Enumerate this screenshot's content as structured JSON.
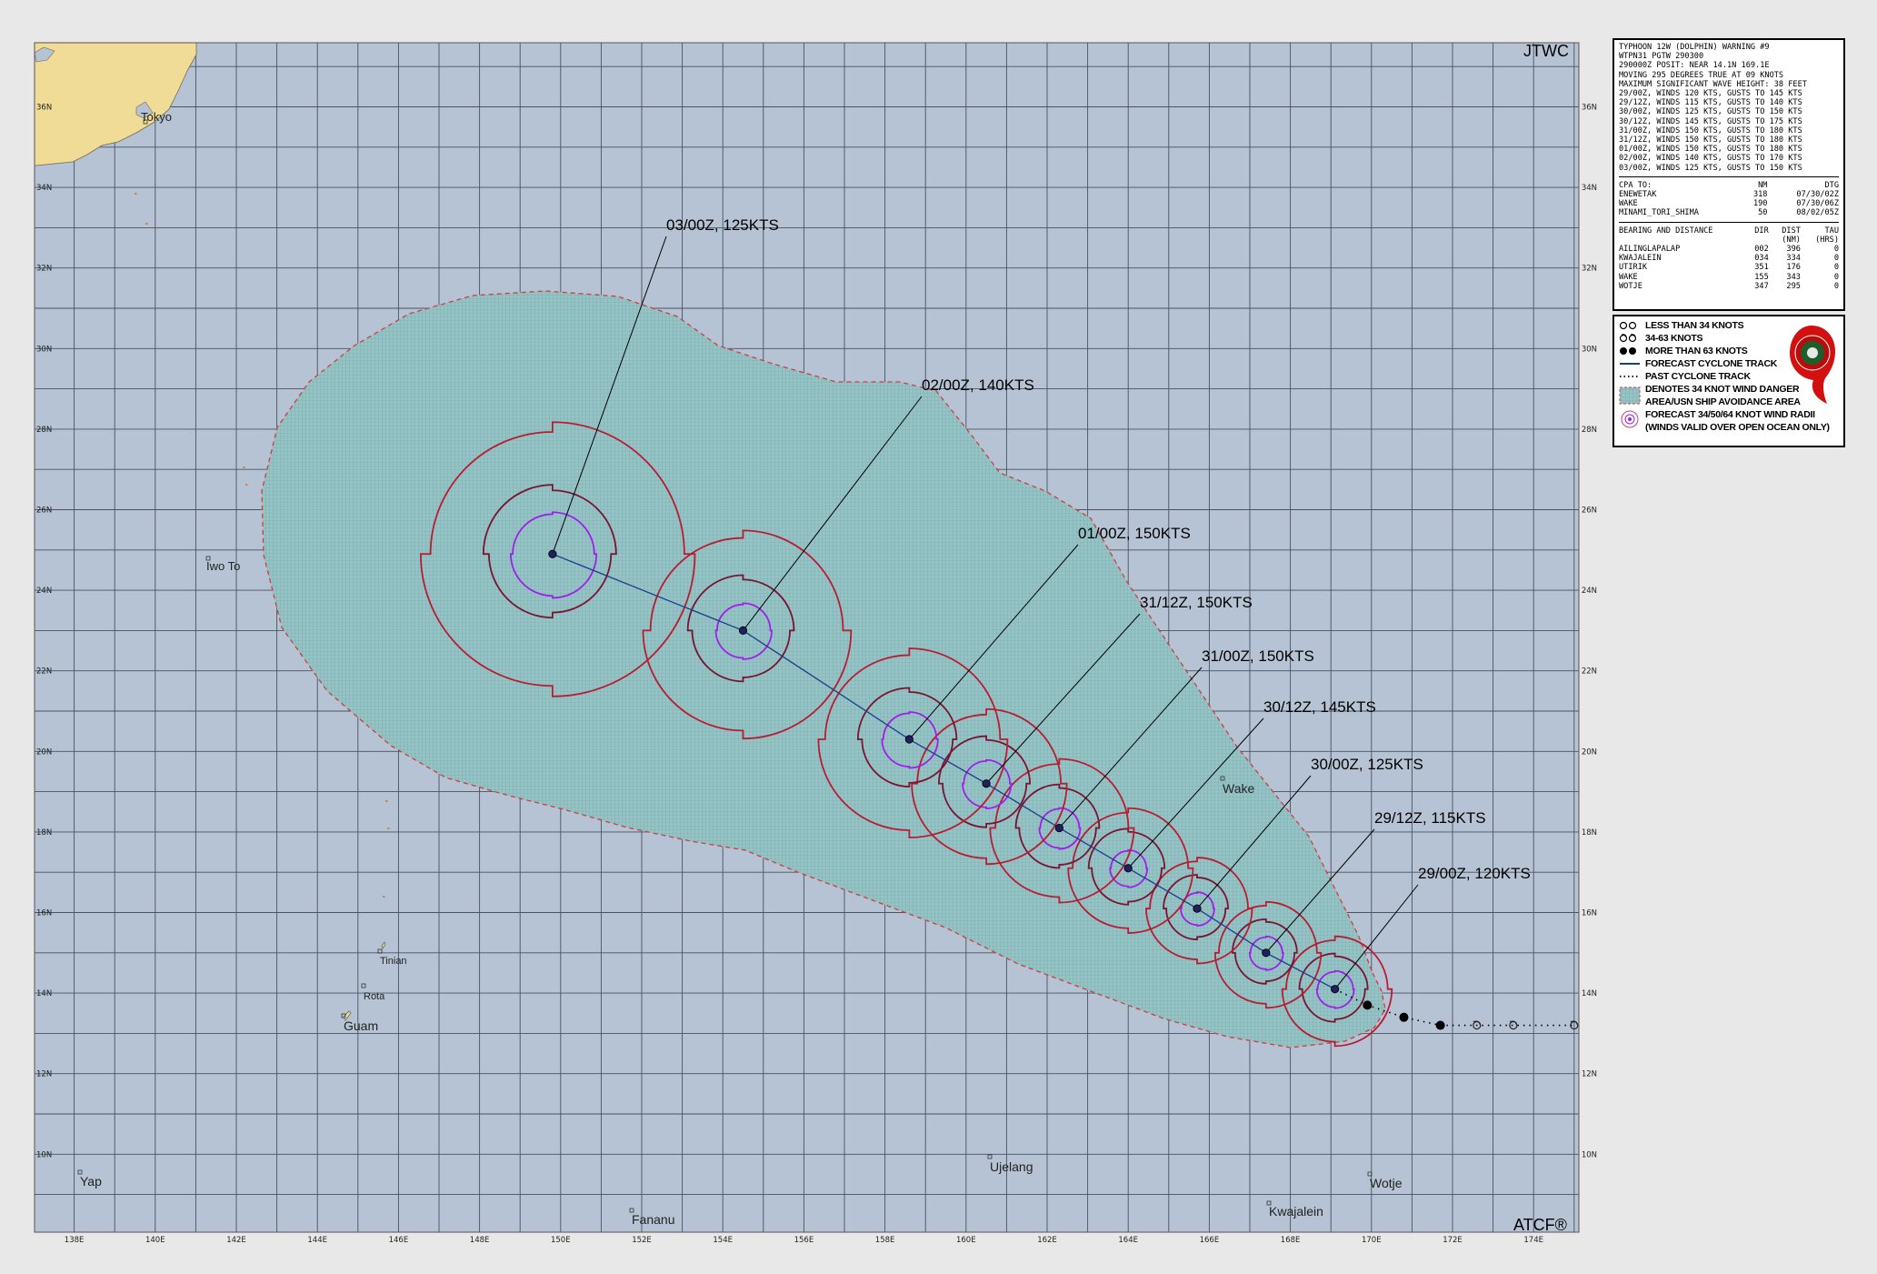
{
  "agency": "JTWC",
  "footer": "ATCF®",
  "lat_labels": [
    "36N",
    "34N",
    "32N",
    "30N",
    "28N",
    "26N",
    "24N",
    "22N",
    "20N",
    "18N",
    "16N",
    "14N",
    "12N",
    "10N"
  ],
  "lon_labels": [
    "138E",
    "140E",
    "142E",
    "144E",
    "146E",
    "148E",
    "150E",
    "152E",
    "154E",
    "156E",
    "158E",
    "160E",
    "162E",
    "164E",
    "166E",
    "168E",
    "170E",
    "172E",
    "174E"
  ],
  "places": [
    {
      "name": "Tokyo"
    },
    {
      "name": "Iwo To"
    },
    {
      "name": "Tinian"
    },
    {
      "name": "Rota"
    },
    {
      "name": "Guam"
    },
    {
      "name": "Yap"
    },
    {
      "name": "Fananu"
    },
    {
      "name": "Ujelang"
    },
    {
      "name": "Kwajalein"
    },
    {
      "name": "Wotje"
    },
    {
      "name": "Wake"
    }
  ],
  "forecast_labels": [
    "03/00Z, 125KTS",
    "02/00Z, 140KTS",
    "01/00Z, 150KTS",
    "31/12Z, 150KTS",
    "31/00Z, 150KTS",
    "30/12Z, 145KTS",
    "30/00Z, 125KTS",
    "29/12Z, 115KTS",
    "29/00Z, 120KTS"
  ],
  "forecast_track": [
    {
      "time": "29/00Z",
      "lat": 14.1,
      "lon": 169.1,
      "winds_kts": 120
    },
    {
      "time": "29/12Z",
      "lat": 15.0,
      "lon": 167.4,
      "winds_kts": 115
    },
    {
      "time": "30/00Z",
      "lat": 16.1,
      "lon": 165.7,
      "winds_kts": 125
    },
    {
      "time": "30/12Z",
      "lat": 17.1,
      "lon": 164.0,
      "winds_kts": 145
    },
    {
      "time": "31/00Z",
      "lat": 18.1,
      "lon": 162.3,
      "winds_kts": 150
    },
    {
      "time": "31/12Z",
      "lat": 19.2,
      "lon": 160.5,
      "winds_kts": 150
    },
    {
      "time": "01/00Z",
      "lat": 20.3,
      "lon": 158.6,
      "winds_kts": 150
    },
    {
      "time": "02/00Z",
      "lat": 23.0,
      "lon": 154.5,
      "winds_kts": 140
    },
    {
      "time": "03/00Z",
      "lat": 24.9,
      "lon": 149.8,
      "winds_kts": 125
    }
  ],
  "past_track": [
    {
      "lat": 13.7,
      "lon": 169.9
    },
    {
      "lat": 13.4,
      "lon": 170.8
    },
    {
      "lat": 13.2,
      "lon": 171.7
    },
    {
      "lat": 13.2,
      "lon": 172.6
    },
    {
      "lat": 13.2,
      "lon": 173.5
    },
    {
      "lat": 13.2,
      "lon": 175.0
    }
  ],
  "warning": {
    "header_lines": [
      "TYPHOON 12W (DOLPHIN) WARNING #9",
      "WTPN31 PGTW 290300",
      "290000Z POSIT: NEAR 14.1N 169.1E",
      "MOVING 295 DEGREES TRUE AT 09 KNOTS",
      "MAXIMUM SIGNIFICANT WAVE HEIGHT: 38 FEET",
      "29/00Z, WINDS 120 KTS, GUSTS TO 145 KTS",
      "29/12Z, WINDS 115 KTS, GUSTS TO 140 KTS",
      "30/00Z, WINDS 125 KTS, GUSTS TO 150 KTS",
      "30/12Z, WINDS 145 KTS, GUSTS TO 175 KTS",
      "31/00Z, WINDS 150 KTS, GUSTS TO 180 KTS",
      "31/12Z, WINDS 150 KTS, GUSTS TO 180 KTS",
      "01/00Z, WINDS 150 KTS, GUSTS TO 180 KTS",
      "02/00Z, WINDS 140 KTS, GUSTS TO 170 KTS",
      "03/00Z, WINDS 125 KTS, GUSTS TO 150 KTS"
    ],
    "cpa": {
      "headers": [
        "CPA TO:",
        "NM",
        "DTG"
      ],
      "rows": [
        [
          "ENEWETAK",
          "318",
          "07/30/02Z"
        ],
        [
          "WAKE",
          "190",
          "07/30/06Z"
        ],
        [
          "MINAMI_TORI_SHIMA",
          "50",
          "08/02/05Z"
        ]
      ]
    },
    "bearing": {
      "headers": [
        "BEARING AND DISTANCE",
        "DIR",
        "DIST",
        "TAU"
      ],
      "units": [
        "",
        "",
        "(NM)",
        "(HRS)"
      ],
      "rows": [
        [
          "AILINGLAPALAP",
          "002",
          "396",
          "0"
        ],
        [
          "KWAJALEIN",
          "034",
          "334",
          "0"
        ],
        [
          "UTIRIK",
          "351",
          "176",
          "0"
        ],
        [
          "WAKE",
          "155",
          "343",
          "0"
        ],
        [
          "WOTJE",
          "347",
          "295",
          "0"
        ]
      ]
    }
  },
  "legend": [
    {
      "icon": "less-than-34-knots-symbol",
      "label": "LESS THAN 34 KNOTS"
    },
    {
      "icon": "34-63-knots-symbol",
      "label": "34-63 KNOTS"
    },
    {
      "icon": "more-than-63-knots-symbol",
      "label": "MORE THAN 63 KNOTS"
    },
    {
      "icon": "forecast-track-line",
      "label": "FORECAST CYCLONE TRACK"
    },
    {
      "icon": "past-track-line",
      "label": "PAST CYCLONE TRACK"
    },
    {
      "icon": "danger-area-swatch",
      "label": "DENOTES 34 KNOT WIND DANGER"
    },
    {
      "icon": "",
      "label": "AREA/USN SHIP AVOIDANCE AREA"
    },
    {
      "icon": "wind-radii-symbol",
      "label": "FORECAST 34/50/64 KNOT WIND RADII"
    },
    {
      "icon": "",
      "label": "(WINDS VALID OVER OPEN OCEAN ONLY)"
    }
  ],
  "colors": {
    "ocean": "#b5c3d4",
    "land": "#f0dc96",
    "danger_area": "#93c3c6",
    "danger_border": "#d23c3c",
    "radii_34": "#b81d30",
    "radii_50": "#7a1430",
    "radii_64": "#a020e8",
    "track": "#1e3c8c",
    "grid": "#48535f"
  }
}
